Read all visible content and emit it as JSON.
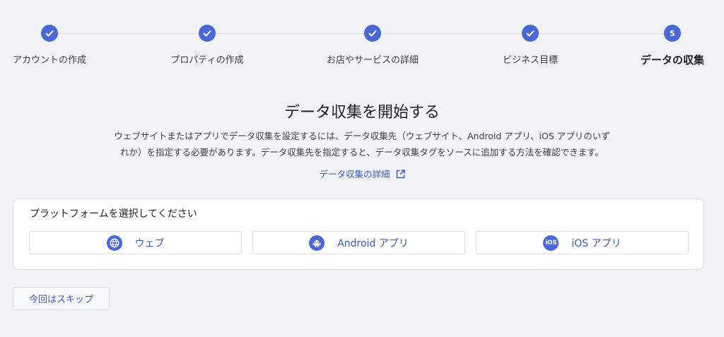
{
  "stepper": {
    "steps": [
      {
        "label": "アカウントの作成",
        "state": "done"
      },
      {
        "label": "プロパティの作成",
        "state": "done"
      },
      {
        "label": "お店やサービスの詳細",
        "state": "done"
      },
      {
        "label": "ビジネス目標",
        "state": "done"
      },
      {
        "label": "データの収集",
        "state": "active",
        "number": "5"
      }
    ]
  },
  "intro": {
    "title": "データ収集を開始する",
    "description_line1": "ウェブサイトまたはアプリでデータ収集を設定するには、データ収集先（ウェブサイト、Android アプリ、iOS アプリのいず",
    "description_line2": "れか）を指定する必要があります。データ収集先を指定すると、データ収集タグをソースに追加する方法を確認できます。",
    "learn_more": "データ収集の詳細"
  },
  "platform_card": {
    "title": "プラットフォームを選択してください",
    "buttons": [
      {
        "label": "ウェブ",
        "icon": "globe-icon"
      },
      {
        "label": "Android アプリ",
        "icon": "android-icon"
      },
      {
        "label": "iOS アプリ",
        "icon": "ios-icon",
        "icon_text": "iOS"
      }
    ]
  },
  "skip_label": "今回はスキップ",
  "colors": {
    "accent": "#4a67d8",
    "link": "#3b59c4",
    "background": "#f1f3f7"
  }
}
